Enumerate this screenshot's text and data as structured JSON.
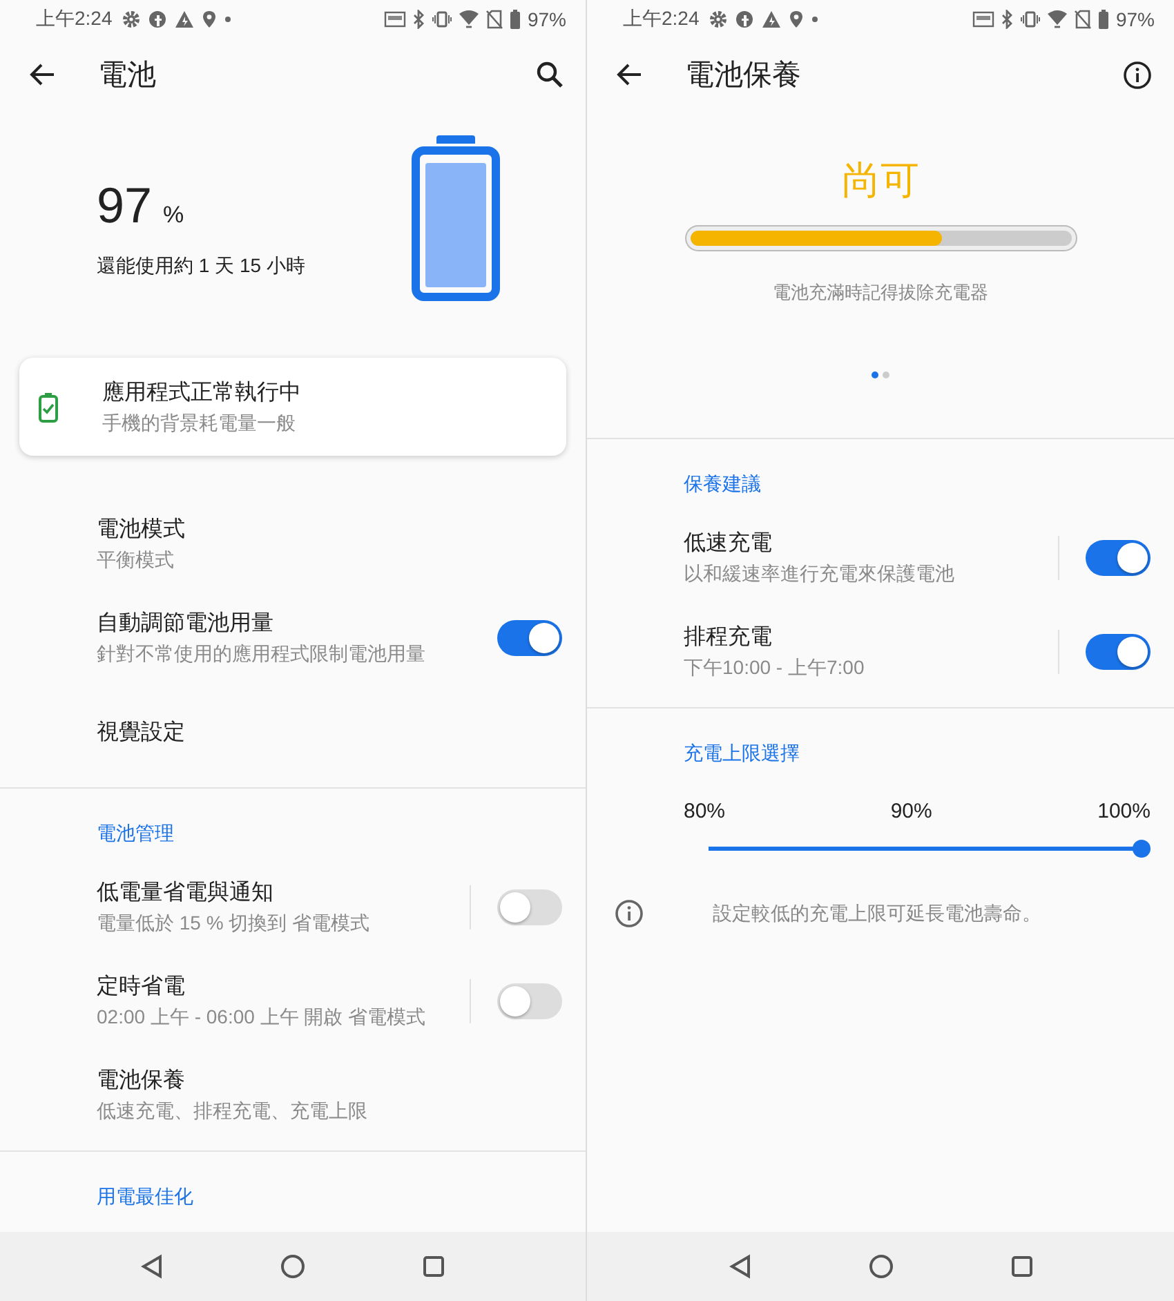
{
  "screens": [
    {
      "status_bar": {
        "time": "上午2:24",
        "battery": "97%"
      },
      "title": "電池",
      "hero": {
        "percent": "97",
        "unit": "%",
        "remaining": "還能使用約 1 天 15 小時",
        "level": 0.97
      },
      "card": {
        "title": "應用程式正常執行中",
        "subtitle": "手機的背景耗電量一般"
      },
      "sections": [
        {
          "items": [
            {
              "kind": "plain",
              "title": "電池模式",
              "subtitle": "平衡模式"
            },
            {
              "kind": "toggle",
              "title": "自動調節電池用量",
              "subtitle": "針對不常使用的應用程式限制電池用量",
              "on": true
            },
            {
              "kind": "plain",
              "title": "視覺設定"
            }
          ]
        },
        {
          "header": "電池管理",
          "items": [
            {
              "kind": "split_toggle",
              "title": "低電量省電與通知",
              "subtitle": "電量低於 15 % 切換到 省電模式",
              "on": false
            },
            {
              "kind": "split_toggle",
              "title": "定時省電",
              "subtitle": "02:00 上午 - 06:00 上午 開啟 省電模式",
              "on": false
            },
            {
              "kind": "plain",
              "title": "電池保養",
              "subtitle": "低速充電、排程充電、充電上限"
            }
          ]
        },
        {
          "header": "用電最佳化"
        }
      ]
    },
    {
      "status_bar": {
        "time": "上午2:24",
        "battery": "97%"
      },
      "title": "電池保養",
      "health": {
        "rating": "尚可",
        "level": 0.66,
        "caption": "電池充滿時記得拔除充電器",
        "pages": [
          {
            "selected": true
          },
          {
            "selected": false
          }
        ]
      },
      "sections": [
        {
          "header": "保養建議",
          "items": [
            {
              "kind": "split_toggle",
              "title": "低速充電",
              "subtitle": "以和緩速率進行充電來保護電池",
              "on": true
            },
            {
              "kind": "split_toggle",
              "title": "排程充電",
              "subtitle": "下午10:00 - 上午7:00",
              "on": true
            }
          ]
        }
      ],
      "limit": {
        "header": "充電上限選擇",
        "labels": [
          "80%",
          "90%",
          "100%"
        ],
        "level": 1
      },
      "note": "設定較低的充電上限可延長電池壽命。"
    }
  ]
}
